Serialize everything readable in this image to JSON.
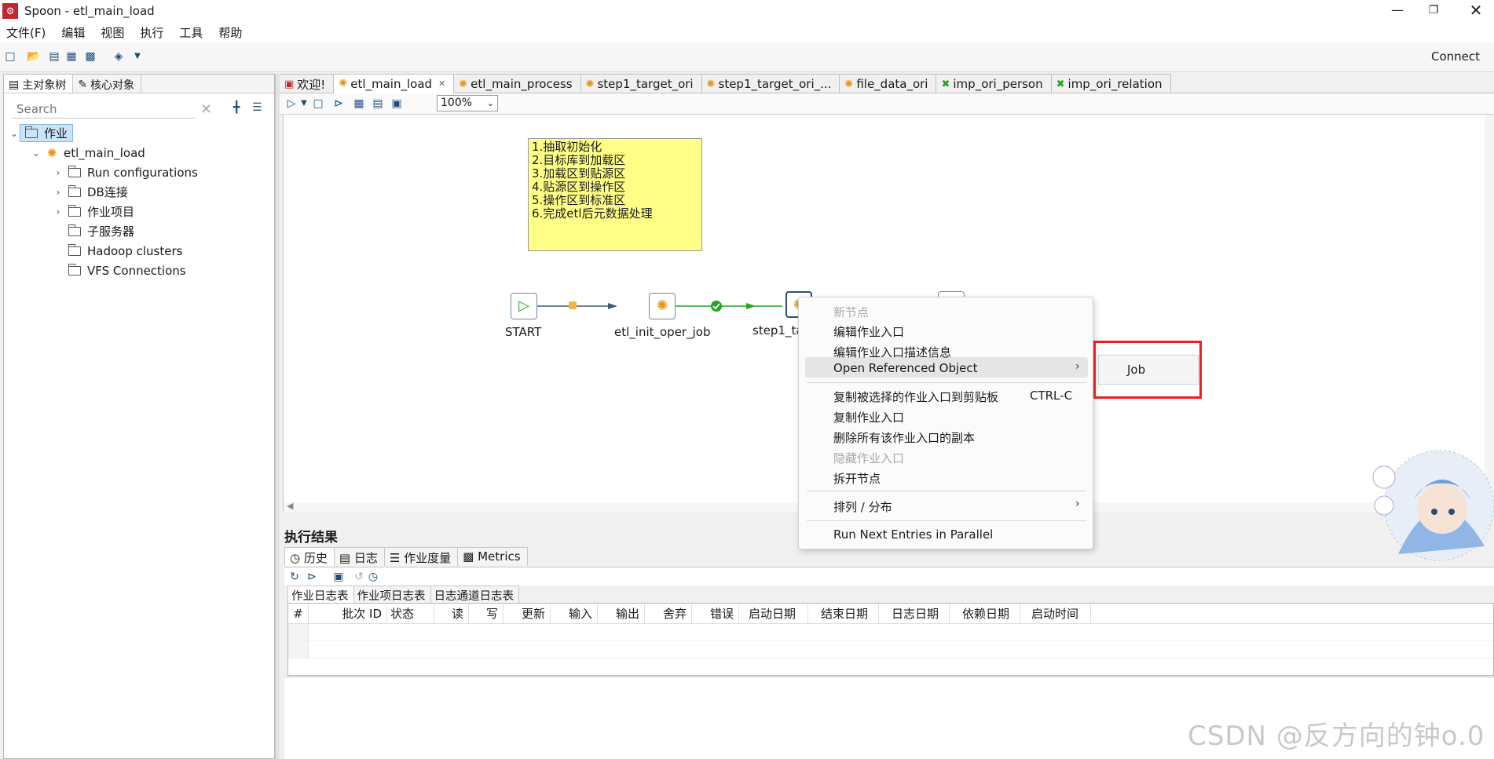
{
  "window": {
    "title": "Spoon - etl_main_load",
    "app_icon_glyph": "⚙"
  },
  "menubar": [
    "文件(F)",
    "编辑",
    "视图",
    "执行",
    "工具",
    "帮助"
  ],
  "toolbar": {
    "connect_label": "Connect"
  },
  "left_panel": {
    "tabs": [
      "主对象树",
      "核心对象"
    ],
    "search_placeholder": "Search",
    "tree": {
      "root": "作业",
      "job": "etl_main_load",
      "children": [
        "Run configurations",
        "DB连接",
        "作业项目",
        "子服务器",
        "Hadoop clusters",
        "VFS Connections"
      ]
    }
  },
  "editor_tabs": [
    "欢迎!",
    "etl_main_load",
    "etl_main_process",
    "step1_target_ori",
    "step1_target_ori_...",
    "file_data_ori",
    "imp_ori_person",
    "imp_ori_relation"
  ],
  "canvas": {
    "zoom": "100%",
    "note_lines": [
      "1.抽取初始化",
      "2.目标库到加载区",
      "3.加载区到贴源区",
      "4.贴源区到操作区",
      "5.操作区到标准区",
      "6.完成etl后元数据处理"
    ],
    "nodes": [
      "START",
      "etl_init_oper_job",
      "step1_ta"
    ]
  },
  "context_menu": {
    "header": "新节点",
    "items": [
      "编辑作业入口",
      "编辑作业入口描述信息",
      "Open Referenced Object",
      "复制被选择的作业入口到剪贴板",
      "复制作业入口",
      "删除所有该作业入口的副本",
      "隐藏作业入口",
      "拆开节点",
      "排列 / 分布",
      "Run Next Entries in Parallel"
    ],
    "copy_shortcut": "CTRL-C",
    "submenu_item": "Job"
  },
  "results": {
    "title": "执行结果",
    "tabs": [
      "历史",
      "日志",
      "作业度量",
      "Metrics"
    ],
    "subtabs": [
      "作业日志表",
      "作业项日志表",
      "日志通道日志表"
    ],
    "columns": [
      "#",
      "批次 ID",
      "状态",
      "读",
      "写",
      "更新",
      "输入",
      "输出",
      "舍弃",
      "错误",
      "启动日期",
      "结束日期",
      "日志日期",
      "依赖日期",
      "启动时间"
    ]
  },
  "watermark": "CSDN @反方向的钟o.0",
  "colors": {
    "accent_red": "#e52222",
    "note_yellow": "#ffff88",
    "job_orange": "#e69419",
    "hop_green": "#21a421"
  }
}
